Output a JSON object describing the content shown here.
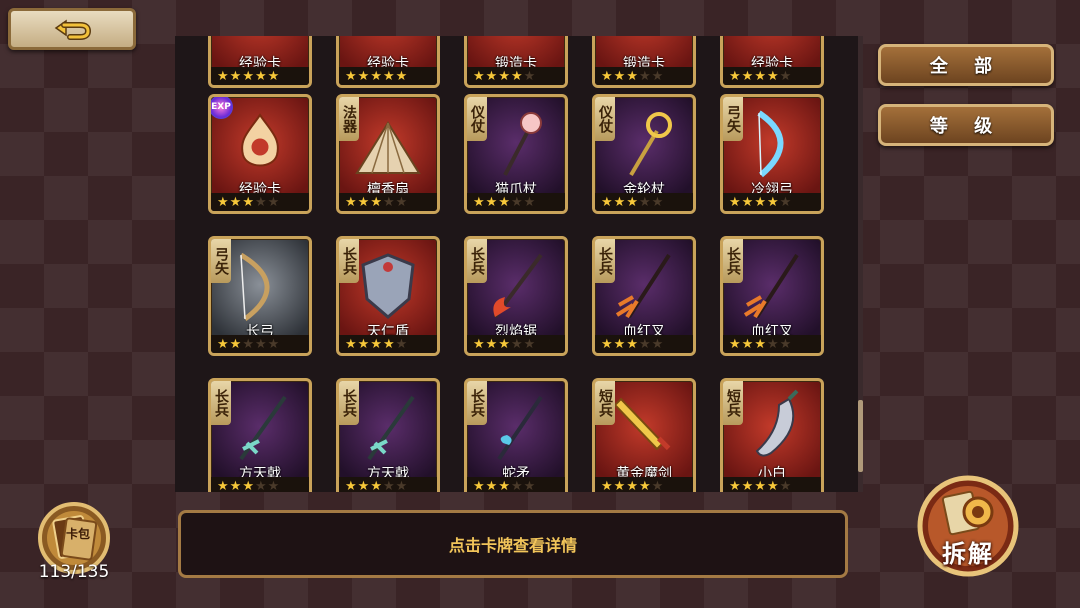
{
  "filters": {
    "all_label": "全 部",
    "level_label": "等 级"
  },
  "info_bar": {
    "text": "点击卡牌查看详情"
  },
  "card_pack": {
    "label": "卡包",
    "count": "113/135"
  },
  "dismantle": {
    "label": "拆解"
  },
  "cards": [
    {
      "name": "经验卡",
      "tag": "",
      "stars": 5,
      "bg": "red",
      "art": "partial"
    },
    {
      "name": "经验卡",
      "tag": "",
      "stars": 5,
      "bg": "red",
      "art": "partial"
    },
    {
      "name": "锻造卡",
      "tag": "",
      "stars": 4,
      "bg": "red",
      "art": "partial"
    },
    {
      "name": "锻造卡",
      "tag": "",
      "stars": 3,
      "bg": "red",
      "art": "partial"
    },
    {
      "name": "经验卡",
      "tag": "",
      "stars": 4,
      "bg": "red",
      "art": "partial"
    },
    {
      "name": "经验卡",
      "tag": "EXP",
      "stars": 3,
      "bg": "red",
      "art": "flame-emblem"
    },
    {
      "name": "檀香扇",
      "tag": "法器",
      "stars": 3,
      "bg": "red",
      "art": "fan"
    },
    {
      "name": "猫爪杖",
      "tag": "仪仗",
      "stars": 3,
      "bg": "purple",
      "art": "paw-staff"
    },
    {
      "name": "金轮杖",
      "tag": "仪仗",
      "stars": 3,
      "bg": "purple",
      "art": "ring-staff"
    },
    {
      "name": "冷翎弓",
      "tag": "弓矢",
      "stars": 4,
      "bg": "red",
      "art": "ice-bow"
    },
    {
      "name": "长弓",
      "tag": "弓矢",
      "stars": 2,
      "bg": "gray",
      "art": "longbow"
    },
    {
      "name": "天仁盾",
      "tag": "长兵",
      "stars": 4,
      "bg": "red",
      "art": "shield"
    },
    {
      "name": "烈焰锯",
      "tag": "长兵",
      "stars": 3,
      "bg": "purple",
      "art": "flame-glaive"
    },
    {
      "name": "血红叉",
      "tag": "长兵",
      "stars": 3,
      "bg": "purple",
      "art": "trident"
    },
    {
      "name": "血红叉",
      "tag": "长兵",
      "stars": 3,
      "bg": "purple",
      "art": "trident"
    },
    {
      "name": "方天戟",
      "tag": "长兵",
      "stars": 3,
      "bg": "purple",
      "art": "halberd"
    },
    {
      "name": "方天戟",
      "tag": "长兵",
      "stars": 3,
      "bg": "purple",
      "art": "halberd"
    },
    {
      "name": "蛇矛",
      "tag": "长兵",
      "stars": 3,
      "bg": "purple",
      "art": "spear"
    },
    {
      "name": "黄金魔剑",
      "tag": "短兵",
      "stars": 4,
      "bg": "red",
      "art": "golden-sword"
    },
    {
      "name": "小白",
      "tag": "短兵",
      "stars": 4,
      "bg": "red",
      "art": "blade"
    }
  ]
}
